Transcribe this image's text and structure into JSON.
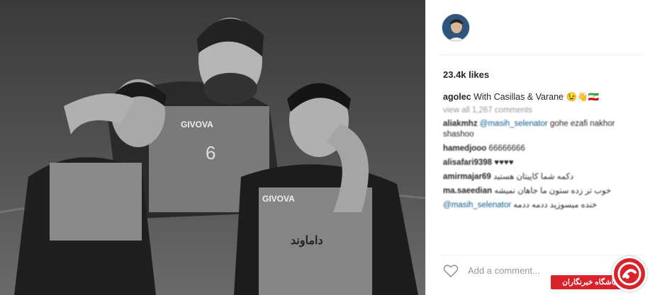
{
  "post": {
    "likes": "23.4k likes",
    "caption_user": "agolec",
    "caption_text": "With Casillas & Varane",
    "caption_emojis": "😉👋🇮🇷",
    "view_all": "view all 1,267 comments",
    "comments": [
      {
        "user": "aliakmhz",
        "mention": "@masih_selenator",
        "text": " gohe ezafi nakhor shashoo"
      },
      {
        "user": "hamedjooo",
        "mention": "",
        "text": " 66666666"
      },
      {
        "user": "alisafari9398",
        "mention": "",
        "text": " ♥♥♥♥"
      },
      {
        "user": "amirmajar69",
        "mention": "",
        "text": " دکمه شما کاپیتان هستید"
      },
      {
        "user": "ma.saeedian",
        "mention": "",
        "text": " خوب تر زده ستون ما جاهان نمیشه"
      },
      {
        "user": "",
        "mention": "@masih_selenator",
        "text": " خنده میسوزید ددمه ددمه"
      }
    ],
    "add_comment_placeholder": "Add a comment...",
    "more_glyph": "•••"
  },
  "watermark": {
    "banner_text": "باشگاه خبرنگاران",
    "color": "#d8232a"
  },
  "photo": {
    "jersey_brand": "GIVOVA",
    "jersey_number": "6",
    "sponsor_text": "داماوند"
  }
}
